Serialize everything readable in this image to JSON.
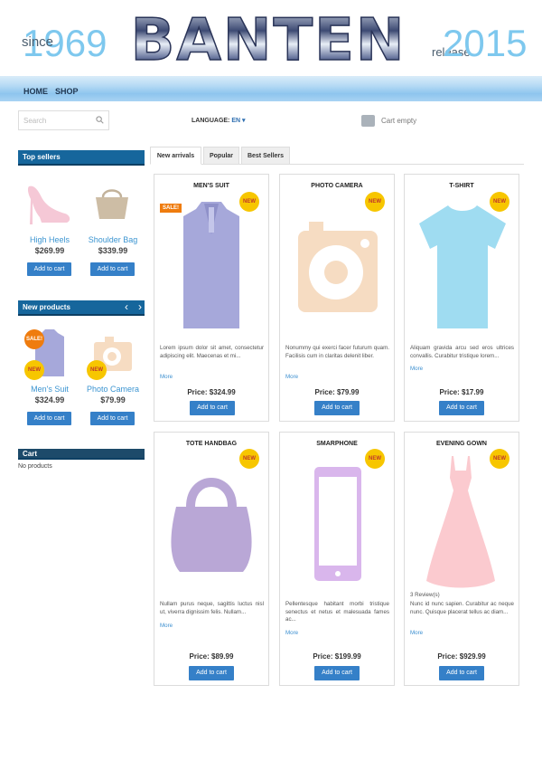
{
  "header": {
    "since": "since",
    "year_start": "1969",
    "brand": "BANTEN",
    "release": "release",
    "year_end": "2015"
  },
  "nav": {
    "home": "HOME",
    "shop": "SHOP"
  },
  "search": {
    "placeholder": "Search"
  },
  "language": {
    "label": "LANGUAGE:",
    "value": "EN"
  },
  "cart_status": "Cart empty",
  "sidebar": {
    "top_sellers": {
      "title": "Top sellers",
      "items": [
        {
          "name": "High Heels",
          "price": "$269.99",
          "button": "Add to cart"
        },
        {
          "name": "Shoulder Bag",
          "price": "$339.99",
          "button": "Add to cart"
        }
      ]
    },
    "new_products": {
      "title": "New products",
      "items": [
        {
          "name": "Men's Suit",
          "price": "$324.99",
          "button": "Add to cart",
          "badge": "NEW",
          "sale": "SALE!"
        },
        {
          "name": "Photo Camera",
          "price": "$79.99",
          "button": "Add to cart",
          "badge": "NEW"
        }
      ]
    },
    "cart": {
      "title": "Cart",
      "empty": "No products"
    }
  },
  "tabs": [
    "New arrivals",
    "Popular",
    "Best Sellers"
  ],
  "products": [
    {
      "title": "MEN'S SUIT",
      "badge": "NEW",
      "sale": "SALE!",
      "desc": "Lorem ipsum dolor sit amet, consectetur adipiscing elit. Maecenas et mi...",
      "more": "More",
      "price": "Price: $324.99",
      "button": "Add to cart"
    },
    {
      "title": "PHOTO CAMERA",
      "badge": "NEW",
      "desc": "Nonummy qui exerci facer futurum quam. Facilisis cum in claritas delenit liber.",
      "more": "More",
      "price": "Price: $79.99",
      "button": "Add to cart"
    },
    {
      "title": "T-SHIRT",
      "badge": "NEW",
      "desc": "Aliquam gravida arcu sed eros ultrices convallis. Curabitur tristique lorem...",
      "more": "More",
      "price": "Price: $17.99",
      "button": "Add to cart"
    },
    {
      "title": "TOTE HANDBAG",
      "badge": "NEW",
      "desc": "Nullam purus neque, sagittis luctus nisl ut, viverra dignissim felis. Nullam...",
      "more": "More",
      "price": "Price: $89.99",
      "button": "Add to cart"
    },
    {
      "title": "SMARPHONE",
      "badge": "NEW",
      "desc": "Pellentesque habitant morbi tristique senectus et netus et malesuada fames ac...",
      "more": "More",
      "price": "Price: $199.99",
      "button": "Add to cart"
    },
    {
      "title": "EVENING GOWN",
      "badge": "NEW",
      "reviews": "3 Review(s)",
      "desc": "Nunc id nunc sapien. Curabitur ac neque nunc. Quisque placerat tellus ac diam...",
      "more": "More",
      "price": "Price: $929.99",
      "button": "Add to cart"
    }
  ]
}
